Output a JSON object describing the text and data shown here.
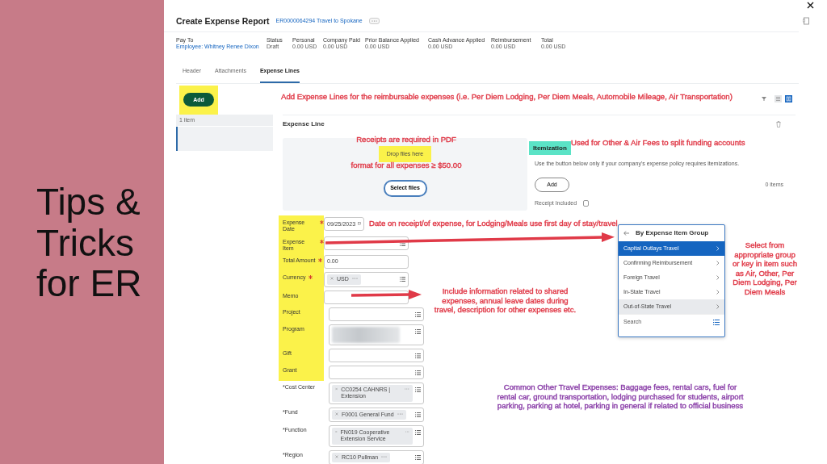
{
  "slide": {
    "title": "Tips & Tricks for ER"
  },
  "header": {
    "title": "Create Expense Report",
    "report_link": "ER0000064294 Travel to Spokane"
  },
  "summary": [
    {
      "label": "Pay To",
      "value": "Employee: Whitney Renee Dixon",
      "link": true
    },
    {
      "label": "Status",
      "value": "Draft",
      "link": false
    },
    {
      "label": "Personal",
      "value": "0.00 USD",
      "link": false
    },
    {
      "label": "Company Paid",
      "value": "0.00 USD",
      "link": false
    },
    {
      "label": "Prior Balance Applied",
      "value": "0.00 USD",
      "link": false
    },
    {
      "label": "Cash Advance Applied",
      "value": "0.00 USD",
      "link": false
    },
    {
      "label": "Reimbursement",
      "value": "0.00 USD",
      "link": false
    },
    {
      "label": "Total",
      "value": "0.00 USD",
      "link": false
    }
  ],
  "tabs": [
    {
      "label": "Header",
      "selected": false
    },
    {
      "label": "Attachments",
      "selected": false
    },
    {
      "label": "Expense Lines",
      "selected": true
    }
  ],
  "add_button": {
    "label": "Add",
    "highlighted": true
  },
  "item_list": {
    "count": "1 item"
  },
  "view_toggles": [
    {
      "kind": "list",
      "selected": false
    },
    {
      "kind": "grid",
      "selected": true
    }
  ],
  "expense_line": {
    "title": "Expense Line",
    "drop_zone": {
      "text": "Drop files here",
      "button": "Select files",
      "highlighted": true
    },
    "itemization": {
      "title": "Itemization",
      "description": "Use the button below only if your company's expense policy requires itemizations.",
      "button": "Add",
      "count": "0 items",
      "receipt_label": "Receipt Included",
      "receipt_checked": false
    },
    "fields": [
      {
        "label": "Expense Date",
        "required": true,
        "highlighted": true,
        "kind": "date",
        "value": "09/25/2023",
        "prompt": false
      },
      {
        "label": "Expense Item",
        "required": true,
        "highlighted": true,
        "kind": "text",
        "prompt": true
      },
      {
        "label": "Total Amount",
        "required": true,
        "highlighted": true,
        "kind": "text",
        "value": "0.00",
        "prompt": false
      },
      {
        "label": "Currency",
        "required": true,
        "highlighted": true,
        "kind": "chips",
        "chips": [
          "USD"
        ],
        "prompt": true
      },
      {
        "label": "Memo",
        "required": false,
        "highlighted": true,
        "kind": "text",
        "prompt": false
      }
    ],
    "accounting_fields": [
      {
        "label": "Project",
        "highlighted": true,
        "kind": "text",
        "prompt": true
      },
      {
        "label": "Program",
        "highlighted": true,
        "kind": "blurred",
        "prompt": true
      },
      {
        "label": "Gift",
        "highlighted": true,
        "kind": "text",
        "prompt": true
      },
      {
        "label": "Grant",
        "highlighted": true,
        "kind": "text",
        "prompt": true
      },
      {
        "label": "*Cost Center",
        "highlighted": false,
        "kind": "chips",
        "chips": [
          "CC0254 CAHNRS | Extension"
        ],
        "prompt": true
      },
      {
        "label": "*Fund",
        "highlighted": false,
        "kind": "chips",
        "chips": [
          "F0001 General Fund"
        ],
        "prompt": true
      },
      {
        "label": "*Function",
        "highlighted": false,
        "kind": "chips",
        "chips": [
          "FN019 Cooperative Extension Service"
        ],
        "prompt": true
      },
      {
        "label": "*Region",
        "highlighted": false,
        "kind": "chips",
        "chips": [
          "RC10 Pullman"
        ],
        "prompt": true
      }
    ]
  },
  "dropdown": {
    "title": "By Expense Item Group",
    "items": [
      {
        "label": "Capital Outlays Travel",
        "selected": true,
        "hovered": false
      },
      {
        "label": "Confirming Reimbursement",
        "selected": false,
        "hovered": false
      },
      {
        "label": "Foreign Travel",
        "selected": false,
        "hovered": false
      },
      {
        "label": "In-State Travel",
        "selected": false,
        "hovered": false
      },
      {
        "label": "Out-of-State Travel",
        "selected": false,
        "hovered": true
      }
    ],
    "search": {
      "placeholder": "Search"
    }
  },
  "annotations": [
    {
      "text": "Add Expense Lines for the reimbursable expenses (i.e. Per Diem Lodging, Per Diem Meals, Automobile Mileage, Air Transportation)",
      "color": "#e03a48"
    },
    {
      "text": "Receipts are required in PDF",
      "color": "#e03a48"
    },
    {
      "text": "format for all expenses ≥ $50.00",
      "color": "#e03a48"
    },
    {
      "text": "Used for Other & Air Fees to split funding accounts",
      "color": "#e03a48"
    },
    {
      "text": "Date on receipt/of expense, for Lodging/Meals use first day of stay/travel",
      "color": "#e03a48"
    },
    {
      "text": "Include information related to shared expenses, annual leave dates during travel, description for other expenses etc.",
      "color": "#e03a48"
    },
    {
      "text": "Select from appropriate group or key in item such as Air, Other, Per Diem Lodging, Per Diem Meals",
      "color": "#e03a48"
    },
    {
      "text": "Common Other Travel Expenses: Baggage fees, rental cars, fuel for rental car, ground transportation, lodging purchased for students, airport parking, parking at hotel, parking in general if related to official business",
      "color": "#8a3fa8"
    }
  ]
}
